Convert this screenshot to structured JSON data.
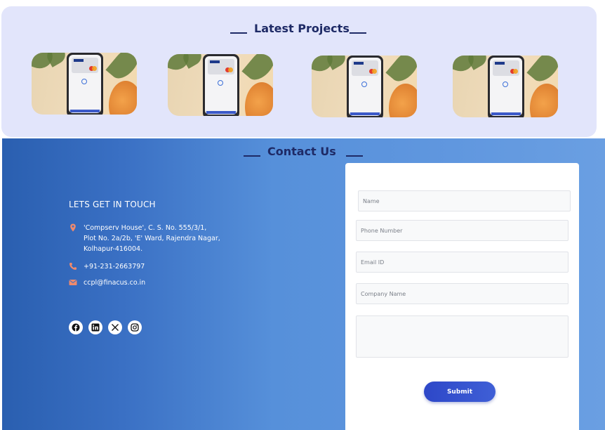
{
  "projects": {
    "title": "Latest Projects",
    "items": [
      {
        "image": "project-photo-1"
      },
      {
        "image": "project-photo-2"
      },
      {
        "image": "project-photo-3"
      },
      {
        "image": "project-photo-4"
      }
    ]
  },
  "contact": {
    "title": "Contact Us",
    "touch_title": "LETS GET IN TOUCH",
    "address": [
      "'Compserv House', C. S. No. 555/3/1,",
      "Plot No. 2a/2b, 'E' Ward, Rajendra Nagar,",
      "Kolhapur-416004."
    ],
    "phone": "+91-231-2663797",
    "email": "ccpl@finacus.co.in",
    "socials": [
      "facebook-icon",
      "linkedin-icon",
      "x-icon",
      "instagram-icon"
    ],
    "icon_color": "#f08a6c"
  },
  "form": {
    "name_placeholder": "Name",
    "phone_placeholder": "Phone Number",
    "email_placeholder": "Email ID",
    "company_placeholder": "Company Name",
    "message_placeholder": "",
    "submit_label": "Submit"
  },
  "colors": {
    "projects_bg": "#e2e5fb",
    "title_color": "#1e2a66",
    "submit_color": "#2d47c8"
  }
}
